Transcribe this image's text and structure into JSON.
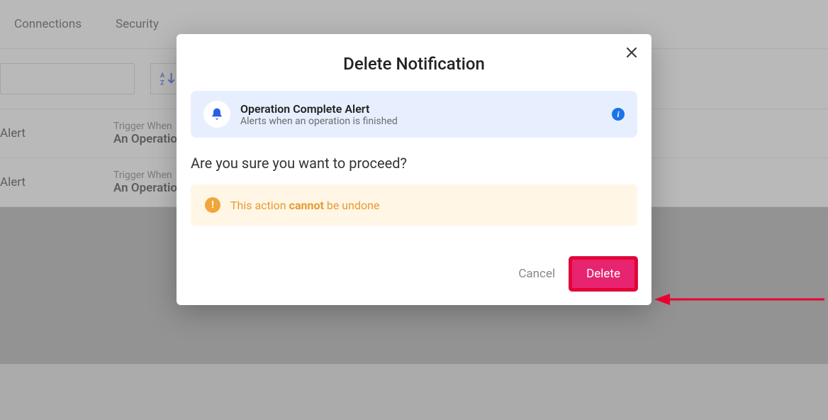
{
  "nav": {
    "items": [
      "Connections",
      "Security"
    ]
  },
  "toolbar": {
    "sort_label": "A↓Z"
  },
  "rows": [
    {
      "left": "Alert",
      "trigger_label": "Trigger When",
      "trigger_value": "An Operation"
    },
    {
      "left": "Alert",
      "trigger_label": "Trigger When",
      "trigger_value": "An Operation"
    }
  ],
  "modal": {
    "title": "Delete Notification",
    "info": {
      "title": "Operation Complete Alert",
      "subtitle": "Alerts when an operation is finished",
      "badge": "i"
    },
    "confirm": "Are you sure you want to proceed?",
    "warn": {
      "icon": "!",
      "prefix": "This action ",
      "bold": "cannot",
      "suffix": " be undone"
    },
    "actions": {
      "cancel": "Cancel",
      "delete": "Delete"
    }
  }
}
